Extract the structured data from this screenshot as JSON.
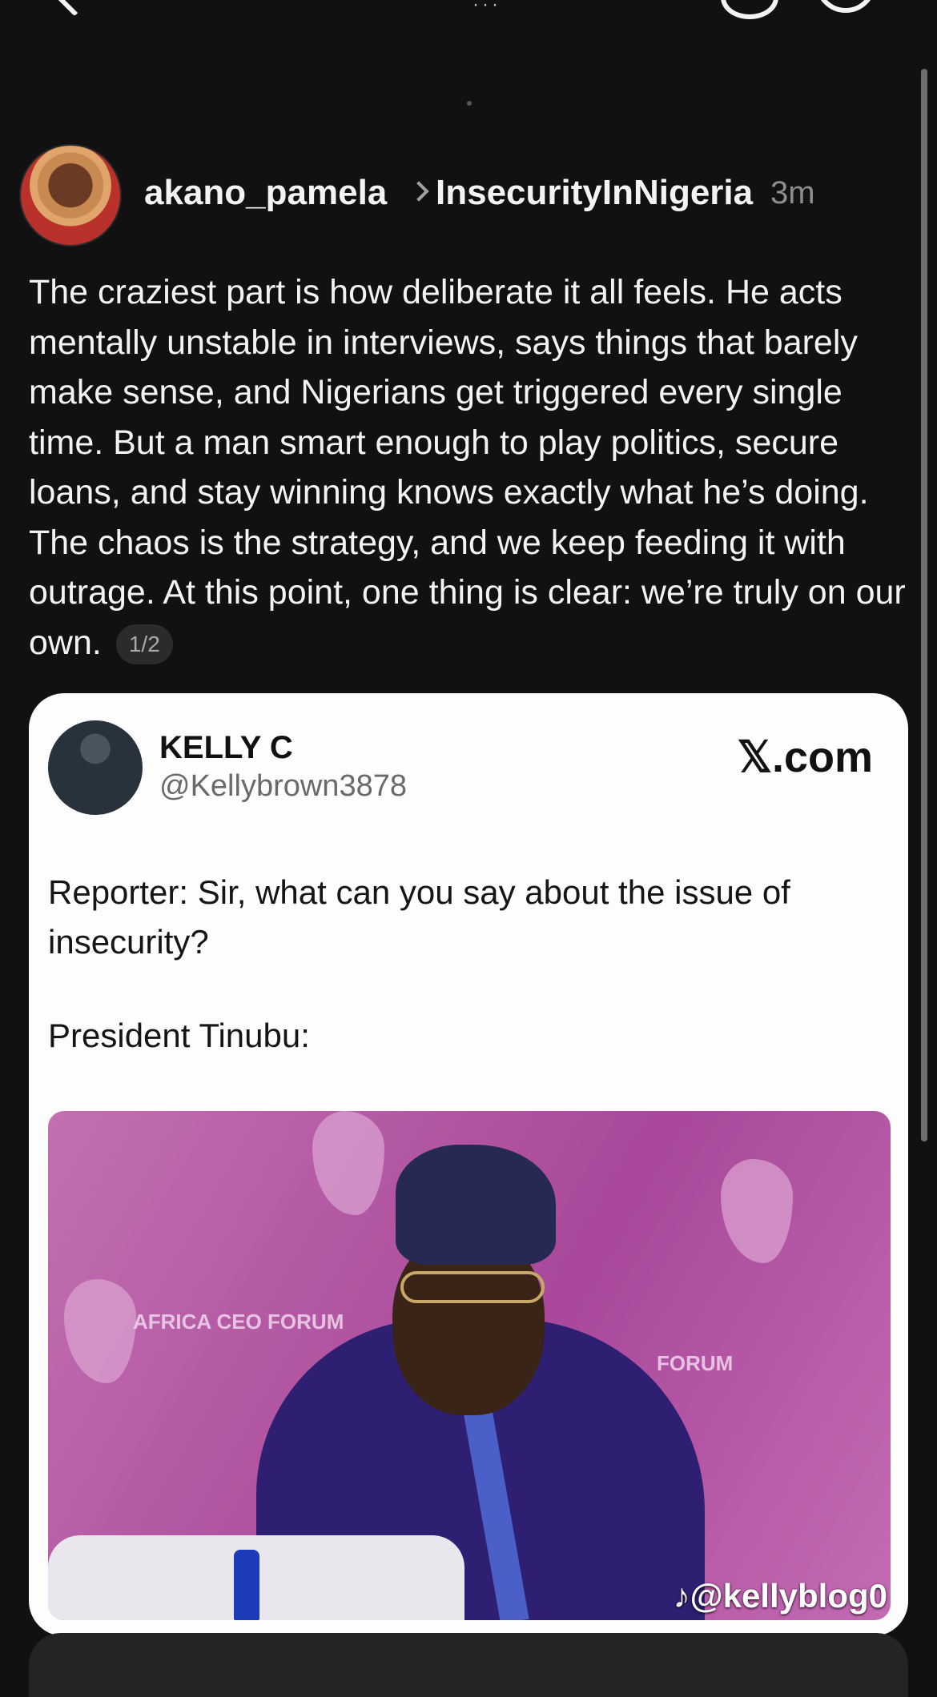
{
  "post": {
    "username": "akano_pamela",
    "topic": "InsecurityInNigeria",
    "time": "3m",
    "text": "The craziest part is how deliberate it all feels. He acts mentally unstable in interviews, says things that barely make sense, and Nigerians get triggered every single time. But a man smart enough to play politics, secure loans, and stay winning knows exactly what he’s doing. The chaos is the strategy, and we keep feeding it with outrage. At this point, one thing is clear: we’re truly on our own.",
    "page_indicator": "1/2"
  },
  "embedded_tweet": {
    "name": "KELLY C",
    "handle": "@Kellybrown3878",
    "source": "𝕏.com",
    "line1": "Reporter: Sir, what can you say about the issue of insecurity?",
    "line2": "President Tinubu:",
    "photo_watermark": "♪@kellyblog0",
    "photo_labels": [
      "AFRICA CEO FORUM",
      "FORUM"
    ]
  }
}
